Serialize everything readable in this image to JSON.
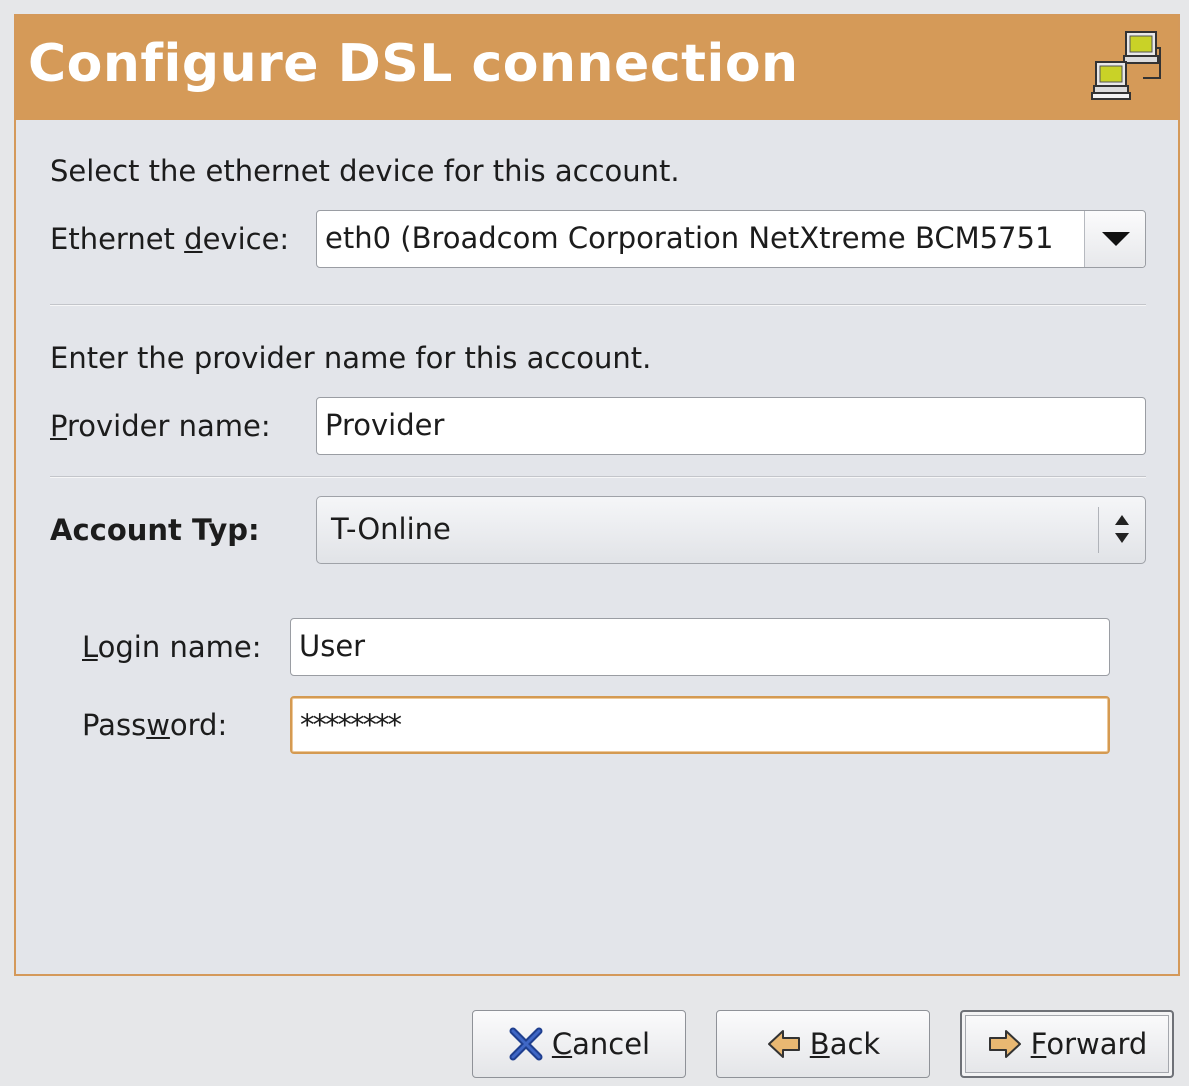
{
  "banner": {
    "title": "Configure DSL connection",
    "icon": "network-computers-icon",
    "color": "#d59a58"
  },
  "ethernet": {
    "instruction": "Select the ethernet device for this account.",
    "label_pre": "Ethernet ",
    "label_mnemonic": "d",
    "label_post": "evice:",
    "value": "eth0 (Broadcom Corporation NetXtreme BCM5751"
  },
  "provider": {
    "instruction": "Enter the provider name for this account.",
    "label_mnemonic": "P",
    "label_post": "rovider name:",
    "value": "Provider"
  },
  "account": {
    "label": "Account Typ:",
    "value": "T-Online"
  },
  "login": {
    "label_mnemonic": "L",
    "label_post": "ogin name:",
    "value": "User"
  },
  "password": {
    "label_pre": "Pass",
    "label_mnemonic": "w",
    "label_post": "ord:",
    "value": "********"
  },
  "buttons": {
    "cancel": {
      "mnemonic": "C",
      "rest": "ancel"
    },
    "back": {
      "mnemonic": "B",
      "rest": "ack"
    },
    "forward": {
      "mnemonic": "F",
      "rest": "orward"
    }
  },
  "accent_color": "#d49a52"
}
